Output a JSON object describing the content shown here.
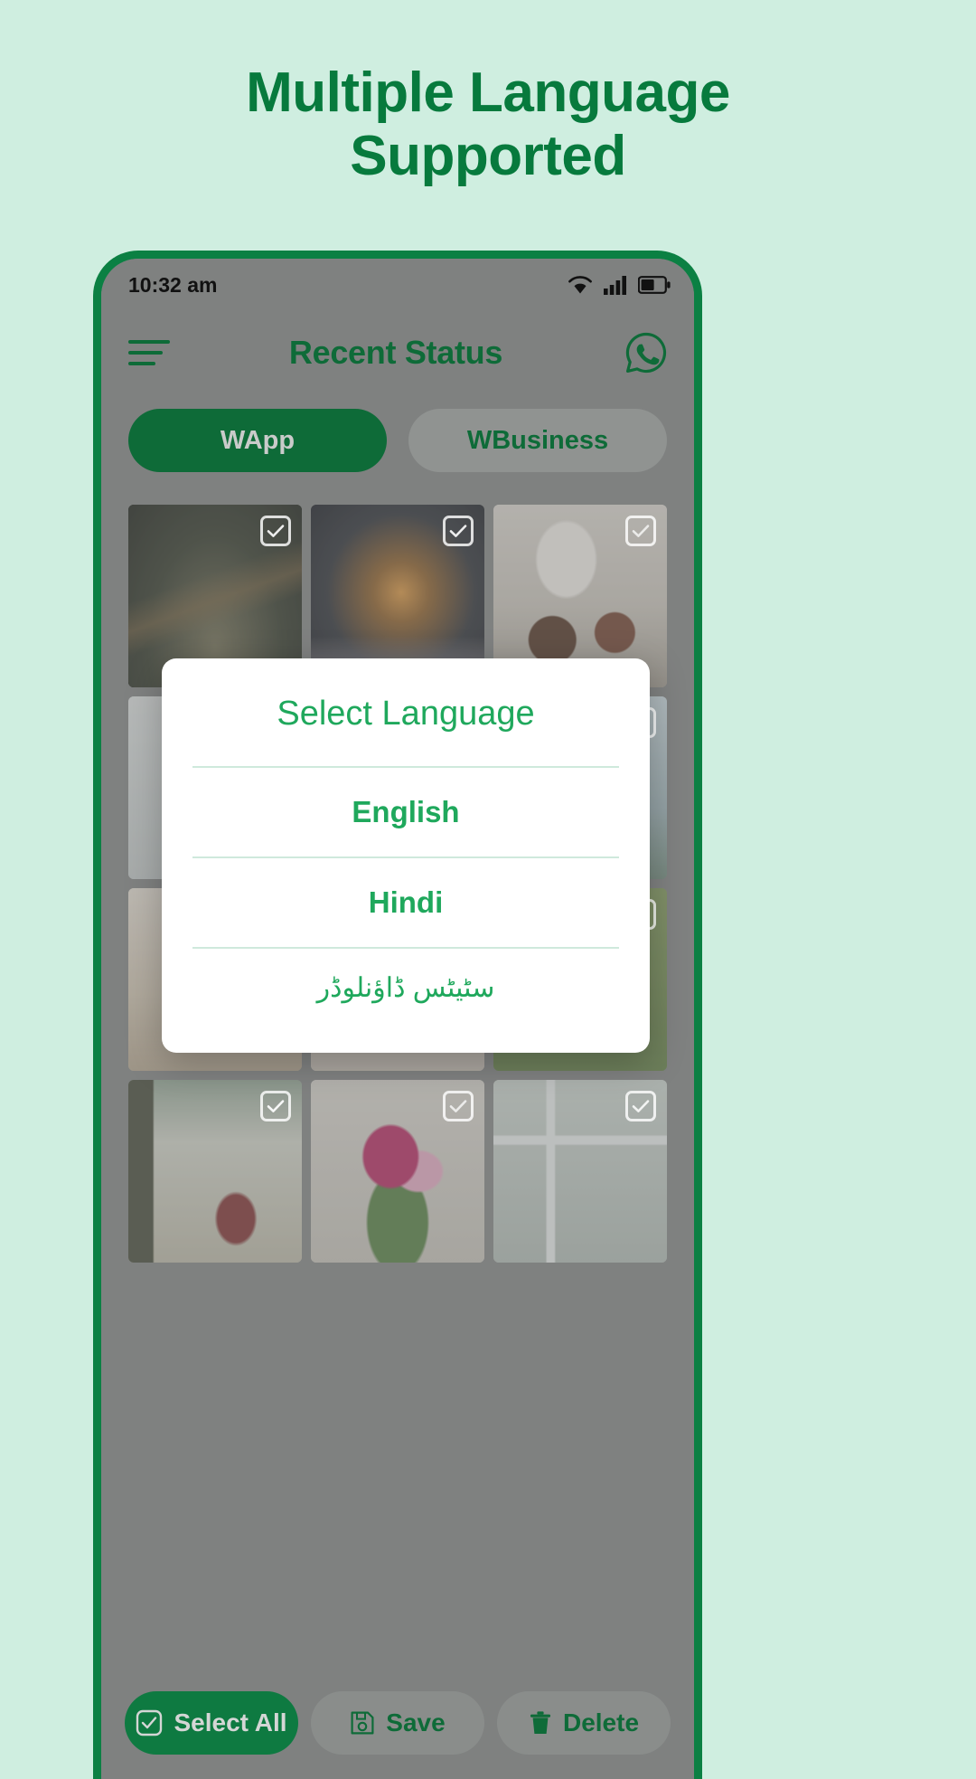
{
  "promo": {
    "line1": "Multiple Language",
    "line2": "Supported",
    "color": "#077a3d"
  },
  "phone": {
    "statusbar": {
      "time": "10:32 am",
      "icons": [
        "wifi-icon",
        "signal-icon",
        "battery-icon"
      ]
    },
    "appbar": {
      "menu_icon": "hamburger-menu-icon",
      "title": "Recent Status",
      "action_icon": "whatsapp-icon"
    },
    "tabs": [
      {
        "label": "WApp",
        "active": true
      },
      {
        "label": "WBusiness",
        "active": false
      }
    ],
    "grid": {
      "checkbox_icon": "check-icon",
      "items": [
        {
          "name": "cabin-in-forest"
        },
        {
          "name": "lit-cabin-at-night"
        },
        {
          "name": "pouring-coffee"
        },
        {
          "name": "white-bottle"
        },
        {
          "name": "water-drop"
        },
        {
          "name": "green-plant"
        },
        {
          "name": "sand-dunes"
        },
        {
          "name": "pink-lilies"
        },
        {
          "name": "yellow-tulips"
        },
        {
          "name": "bicycle-by-lake"
        },
        {
          "name": "flower-bouquet"
        },
        {
          "name": "window-plants"
        }
      ]
    },
    "bottombar": [
      {
        "label": "Select All",
        "icon": "check-square-icon",
        "primary": true
      },
      {
        "label": "Save",
        "icon": "floppy-disk-icon",
        "primary": false
      },
      {
        "label": "Delete",
        "icon": "trash-icon",
        "primary": false
      }
    ]
  },
  "dialog": {
    "title": "Select Language",
    "options": [
      {
        "label": "English",
        "rtl": false
      },
      {
        "label": "Hindi",
        "rtl": false
      },
      {
        "label": "سٹیٹس ڈاؤنلوڈر",
        "rtl": true
      }
    ],
    "accent": "#1fa85c"
  }
}
